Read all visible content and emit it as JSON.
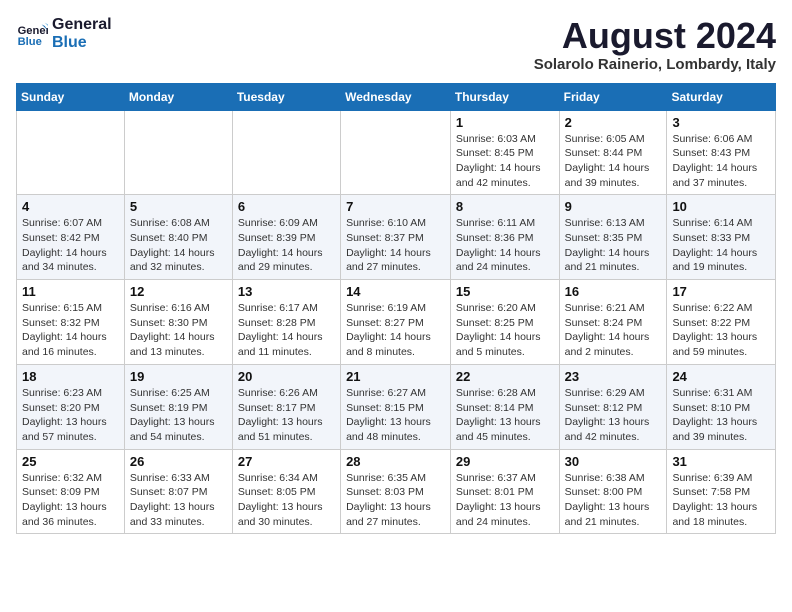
{
  "logo": {
    "line1": "General",
    "line2": "Blue"
  },
  "title": "August 2024",
  "location": "Solarolo Rainerio, Lombardy, Italy",
  "days_of_week": [
    "Sunday",
    "Monday",
    "Tuesday",
    "Wednesday",
    "Thursday",
    "Friday",
    "Saturday"
  ],
  "weeks": [
    [
      {
        "day": "",
        "info": ""
      },
      {
        "day": "",
        "info": ""
      },
      {
        "day": "",
        "info": ""
      },
      {
        "day": "",
        "info": ""
      },
      {
        "day": "1",
        "sunrise": "Sunrise: 6:03 AM",
        "sunset": "Sunset: 8:45 PM",
        "daylight": "Daylight: 14 hours and 42 minutes."
      },
      {
        "day": "2",
        "sunrise": "Sunrise: 6:05 AM",
        "sunset": "Sunset: 8:44 PM",
        "daylight": "Daylight: 14 hours and 39 minutes."
      },
      {
        "day": "3",
        "sunrise": "Sunrise: 6:06 AM",
        "sunset": "Sunset: 8:43 PM",
        "daylight": "Daylight: 14 hours and 37 minutes."
      }
    ],
    [
      {
        "day": "4",
        "sunrise": "Sunrise: 6:07 AM",
        "sunset": "Sunset: 8:42 PM",
        "daylight": "Daylight: 14 hours and 34 minutes."
      },
      {
        "day": "5",
        "sunrise": "Sunrise: 6:08 AM",
        "sunset": "Sunset: 8:40 PM",
        "daylight": "Daylight: 14 hours and 32 minutes."
      },
      {
        "day": "6",
        "sunrise": "Sunrise: 6:09 AM",
        "sunset": "Sunset: 8:39 PM",
        "daylight": "Daylight: 14 hours and 29 minutes."
      },
      {
        "day": "7",
        "sunrise": "Sunrise: 6:10 AM",
        "sunset": "Sunset: 8:37 PM",
        "daylight": "Daylight: 14 hours and 27 minutes."
      },
      {
        "day": "8",
        "sunrise": "Sunrise: 6:11 AM",
        "sunset": "Sunset: 8:36 PM",
        "daylight": "Daylight: 14 hours and 24 minutes."
      },
      {
        "day": "9",
        "sunrise": "Sunrise: 6:13 AM",
        "sunset": "Sunset: 8:35 PM",
        "daylight": "Daylight: 14 hours and 21 minutes."
      },
      {
        "day": "10",
        "sunrise": "Sunrise: 6:14 AM",
        "sunset": "Sunset: 8:33 PM",
        "daylight": "Daylight: 14 hours and 19 minutes."
      }
    ],
    [
      {
        "day": "11",
        "sunrise": "Sunrise: 6:15 AM",
        "sunset": "Sunset: 8:32 PM",
        "daylight": "Daylight: 14 hours and 16 minutes."
      },
      {
        "day": "12",
        "sunrise": "Sunrise: 6:16 AM",
        "sunset": "Sunset: 8:30 PM",
        "daylight": "Daylight: 14 hours and 13 minutes."
      },
      {
        "day": "13",
        "sunrise": "Sunrise: 6:17 AM",
        "sunset": "Sunset: 8:28 PM",
        "daylight": "Daylight: 14 hours and 11 minutes."
      },
      {
        "day": "14",
        "sunrise": "Sunrise: 6:19 AM",
        "sunset": "Sunset: 8:27 PM",
        "daylight": "Daylight: 14 hours and 8 minutes."
      },
      {
        "day": "15",
        "sunrise": "Sunrise: 6:20 AM",
        "sunset": "Sunset: 8:25 PM",
        "daylight": "Daylight: 14 hours and 5 minutes."
      },
      {
        "day": "16",
        "sunrise": "Sunrise: 6:21 AM",
        "sunset": "Sunset: 8:24 PM",
        "daylight": "Daylight: 14 hours and 2 minutes."
      },
      {
        "day": "17",
        "sunrise": "Sunrise: 6:22 AM",
        "sunset": "Sunset: 8:22 PM",
        "daylight": "Daylight: 13 hours and 59 minutes."
      }
    ],
    [
      {
        "day": "18",
        "sunrise": "Sunrise: 6:23 AM",
        "sunset": "Sunset: 8:20 PM",
        "daylight": "Daylight: 13 hours and 57 minutes."
      },
      {
        "day": "19",
        "sunrise": "Sunrise: 6:25 AM",
        "sunset": "Sunset: 8:19 PM",
        "daylight": "Daylight: 13 hours and 54 minutes."
      },
      {
        "day": "20",
        "sunrise": "Sunrise: 6:26 AM",
        "sunset": "Sunset: 8:17 PM",
        "daylight": "Daylight: 13 hours and 51 minutes."
      },
      {
        "day": "21",
        "sunrise": "Sunrise: 6:27 AM",
        "sunset": "Sunset: 8:15 PM",
        "daylight": "Daylight: 13 hours and 48 minutes."
      },
      {
        "day": "22",
        "sunrise": "Sunrise: 6:28 AM",
        "sunset": "Sunset: 8:14 PM",
        "daylight": "Daylight: 13 hours and 45 minutes."
      },
      {
        "day": "23",
        "sunrise": "Sunrise: 6:29 AM",
        "sunset": "Sunset: 8:12 PM",
        "daylight": "Daylight: 13 hours and 42 minutes."
      },
      {
        "day": "24",
        "sunrise": "Sunrise: 6:31 AM",
        "sunset": "Sunset: 8:10 PM",
        "daylight": "Daylight: 13 hours and 39 minutes."
      }
    ],
    [
      {
        "day": "25",
        "sunrise": "Sunrise: 6:32 AM",
        "sunset": "Sunset: 8:09 PM",
        "daylight": "Daylight: 13 hours and 36 minutes."
      },
      {
        "day": "26",
        "sunrise": "Sunrise: 6:33 AM",
        "sunset": "Sunset: 8:07 PM",
        "daylight": "Daylight: 13 hours and 33 minutes."
      },
      {
        "day": "27",
        "sunrise": "Sunrise: 6:34 AM",
        "sunset": "Sunset: 8:05 PM",
        "daylight": "Daylight: 13 hours and 30 minutes."
      },
      {
        "day": "28",
        "sunrise": "Sunrise: 6:35 AM",
        "sunset": "Sunset: 8:03 PM",
        "daylight": "Daylight: 13 hours and 27 minutes."
      },
      {
        "day": "29",
        "sunrise": "Sunrise: 6:37 AM",
        "sunset": "Sunset: 8:01 PM",
        "daylight": "Daylight: 13 hours and 24 minutes."
      },
      {
        "day": "30",
        "sunrise": "Sunrise: 6:38 AM",
        "sunset": "Sunset: 8:00 PM",
        "daylight": "Daylight: 13 hours and 21 minutes."
      },
      {
        "day": "31",
        "sunrise": "Sunrise: 6:39 AM",
        "sunset": "Sunset: 7:58 PM",
        "daylight": "Daylight: 13 hours and 18 minutes."
      }
    ]
  ]
}
